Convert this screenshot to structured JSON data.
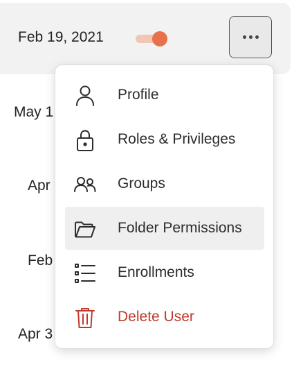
{
  "row": {
    "date": "Feb 19, 2021",
    "toggle_on": true,
    "more_button_label": "More options"
  },
  "background_dates": [
    "May 1",
    "Apr",
    "Feb",
    "Apr 3"
  ],
  "menu": {
    "items": [
      {
        "label": "Profile",
        "icon": "user-icon"
      },
      {
        "label": "Roles & Privileges",
        "icon": "lock-icon"
      },
      {
        "label": "Groups",
        "icon": "users-icon"
      },
      {
        "label": "Folder Permissions",
        "icon": "folder-icon"
      },
      {
        "label": "Enrollments",
        "icon": "list-icon"
      },
      {
        "label": "Delete User",
        "icon": "trash-icon"
      }
    ]
  },
  "colors": {
    "accent": "#e8704a",
    "toggle_track": "#f1c6b3",
    "danger": "#c0392b",
    "row_bg": "#f2f2f2",
    "hover_bg": "#efefef"
  }
}
